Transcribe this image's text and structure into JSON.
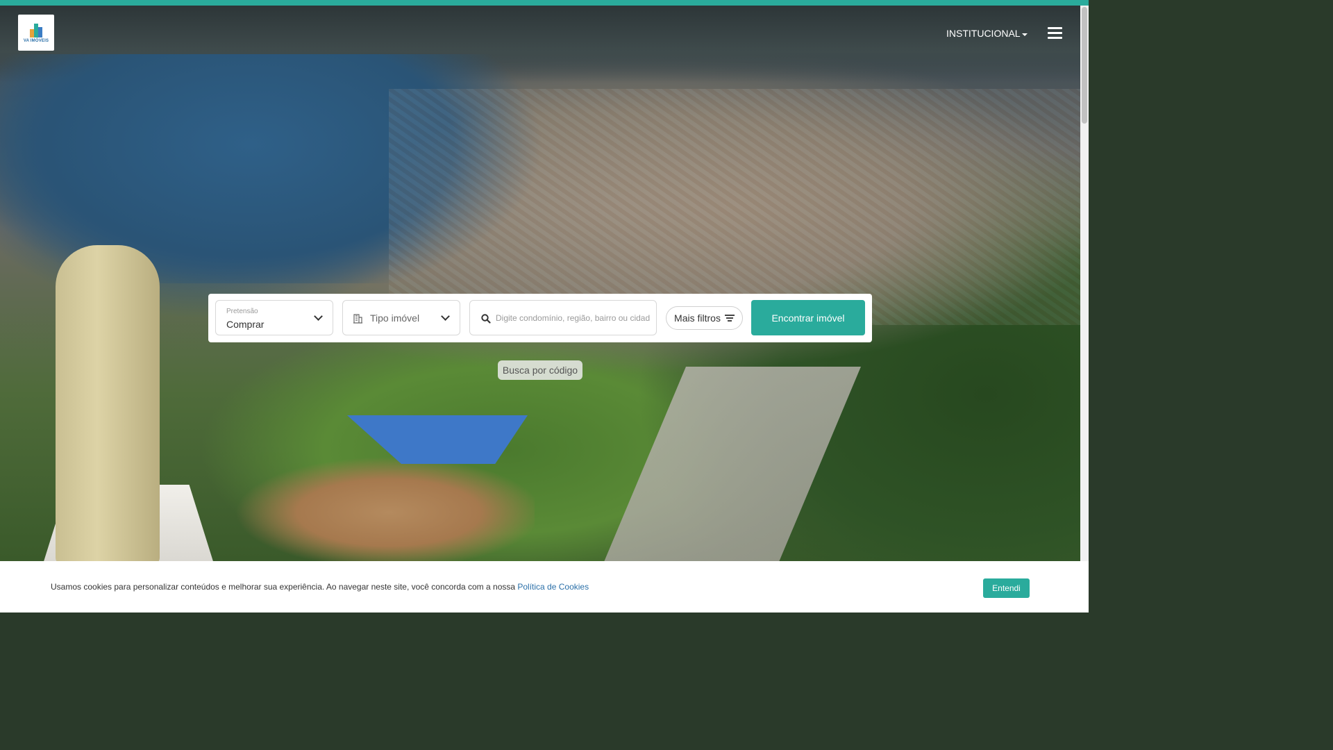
{
  "header": {
    "logo_text": "VA IMÓVEIS",
    "nav_institucional": "INSTITUCIONAL"
  },
  "search": {
    "pretensao_label": "Pretensão",
    "pretensao_value": "Comprar",
    "tipo_placeholder": "Tipo imóvel",
    "search_placeholder": "Digite condomínio, região, bairro ou cidade",
    "filtros_label": "Mais filtros",
    "encontrar_label": "Encontrar imóvel",
    "busca_codigo_label": "Busca por código"
  },
  "cookie": {
    "text": "Usamos cookies para personalizar conteúdos e melhorar sua experiência. Ao navegar neste site, você concorda com a nossa ",
    "link_text": "Política de Cookies",
    "button_label": "Entendi"
  },
  "colors": {
    "accent": "#2aab9c",
    "link": "#2a6fa8"
  }
}
